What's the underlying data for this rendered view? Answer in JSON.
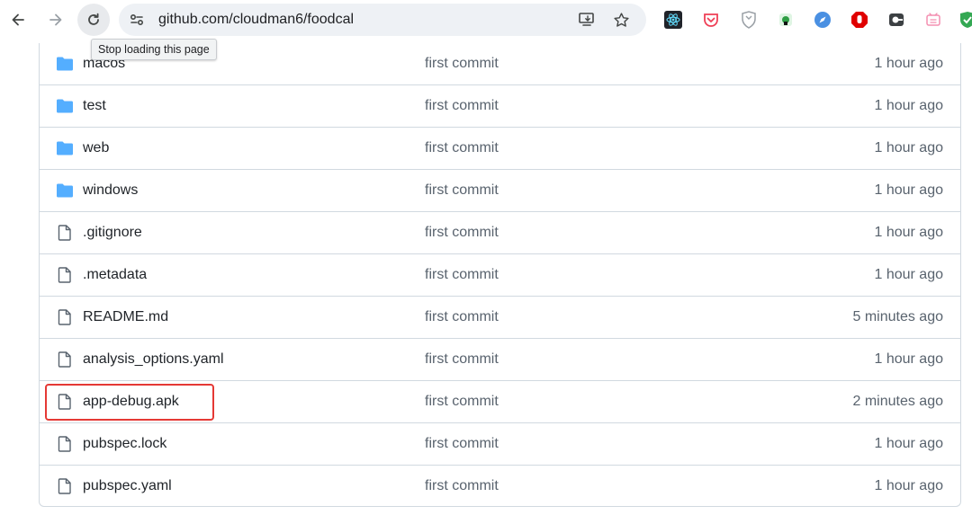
{
  "browser": {
    "url": "github.com/cloudman6/foodcal",
    "tooltip": "Stop loading this page",
    "extensions": [
      "react-devtools-icon",
      "pocket-icon",
      "shield-extension-icon",
      "green-puzzle-icon",
      "compass-icon",
      "stop-hand-icon",
      "gray-extension-icon",
      "pink-extension-icon",
      "green-check-icon"
    ]
  },
  "files": [
    {
      "name": "macos",
      "type": "folder",
      "commit": "first commit",
      "age": "1 hour ago"
    },
    {
      "name": "test",
      "type": "folder",
      "commit": "first commit",
      "age": "1 hour ago"
    },
    {
      "name": "web",
      "type": "folder",
      "commit": "first commit",
      "age": "1 hour ago"
    },
    {
      "name": "windows",
      "type": "folder",
      "commit": "first commit",
      "age": "1 hour ago"
    },
    {
      "name": ".gitignore",
      "type": "file",
      "commit": "first commit",
      "age": "1 hour ago"
    },
    {
      "name": ".metadata",
      "type": "file",
      "commit": "first commit",
      "age": "1 hour ago"
    },
    {
      "name": "README.md",
      "type": "file",
      "commit": "first commit",
      "age": "5 minutes ago"
    },
    {
      "name": "analysis_options.yaml",
      "type": "file",
      "commit": "first commit",
      "age": "1 hour ago"
    },
    {
      "name": "app-debug.apk",
      "type": "file",
      "commit": "first commit",
      "age": "2 minutes ago",
      "highlighted": true
    },
    {
      "name": "pubspec.lock",
      "type": "file",
      "commit": "first commit",
      "age": "1 hour ago"
    },
    {
      "name": "pubspec.yaml",
      "type": "file",
      "commit": "first commit",
      "age": "1 hour ago"
    }
  ],
  "colors": {
    "folder": "#54aeff",
    "highlight": "#e53935"
  }
}
